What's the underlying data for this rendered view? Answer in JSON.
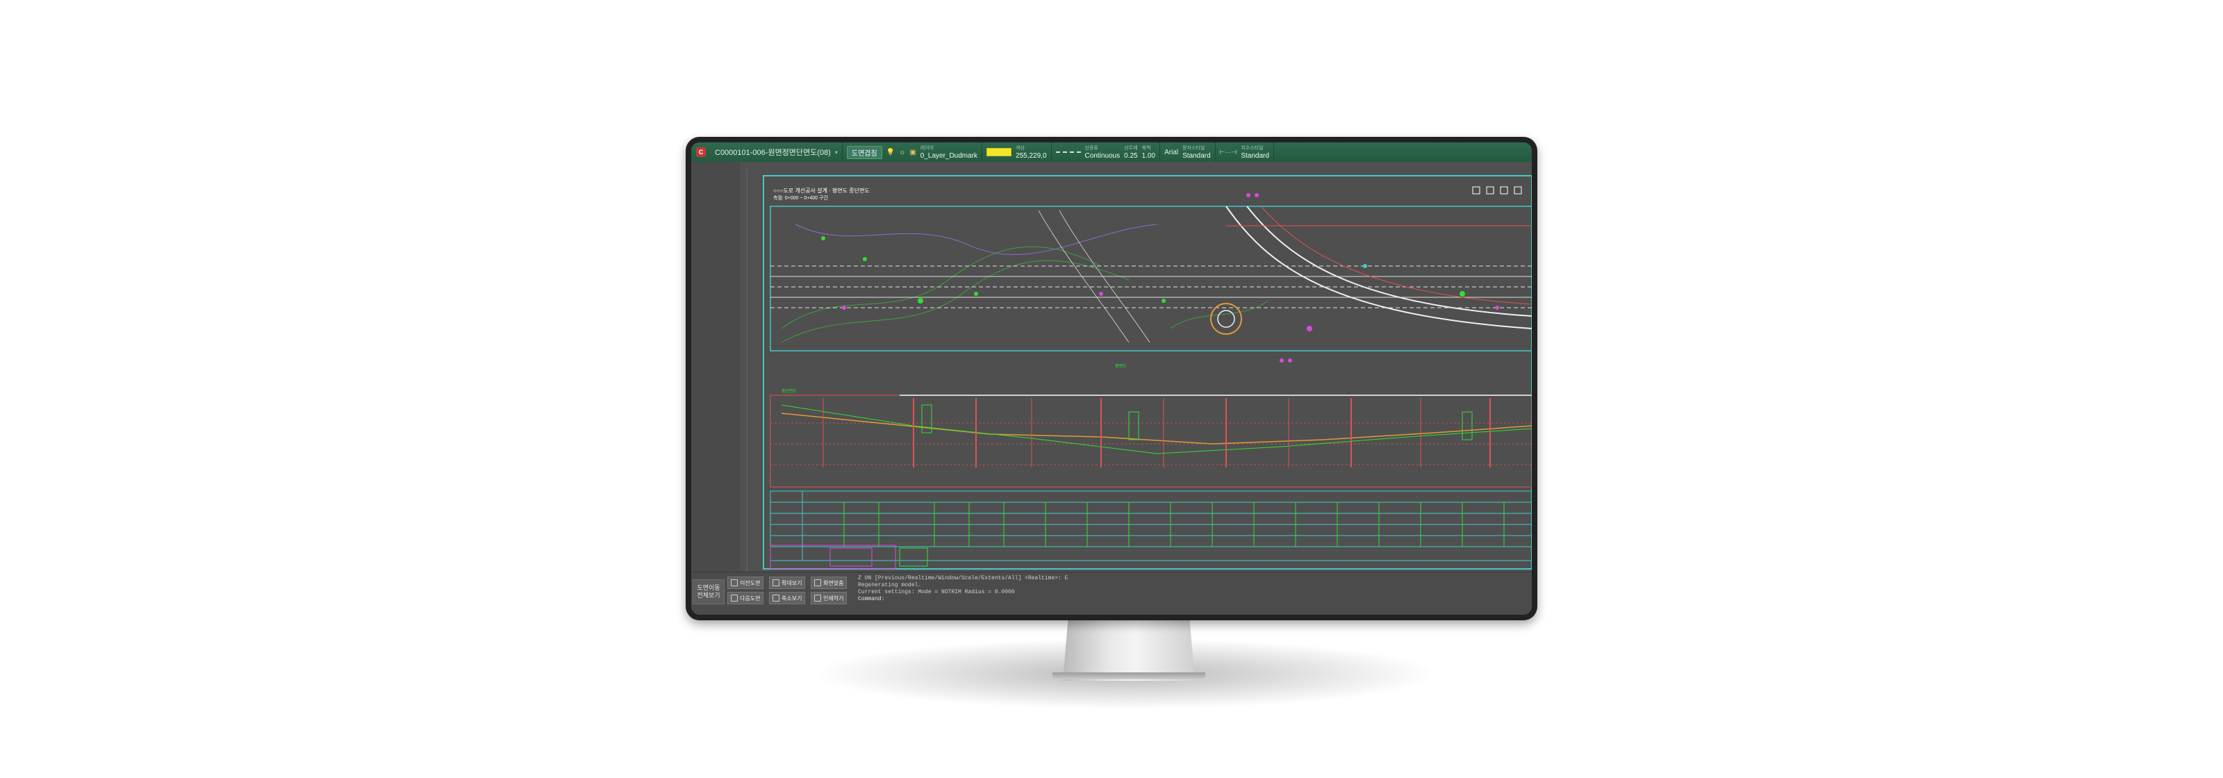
{
  "toolbar": {
    "file_name": "C0000101-006-원면정면단면도(08)",
    "layer_button": "도면겹침",
    "layer_caption": "레이어",
    "layer_name": "0_Layer_Dudmark",
    "color_caption": "색상",
    "color_value": "255,229,0",
    "color_hex": "#f2e62a",
    "linetype_caption": "선종류",
    "linetype_value": "Continuous",
    "lineweight_caption": "선두께",
    "lineweight_value": "0.25",
    "scale_caption": "축척",
    "scale_value": "1.00",
    "font_value": "Arial",
    "textstyle_caption": "문자스타일",
    "textstyle_value": "Standard",
    "dimstyle_caption": "치수스타일",
    "dimstyle_value": "Standard"
  },
  "drawing": {
    "title_line1": "○○○도로 개선공사 설계 · 평면도 종단면도",
    "title_line2": "측점: 0+000 ~ 0+400 구간",
    "plan_label": "평면도",
    "profile_label": "종단면도"
  },
  "bottom": {
    "nav_label": "도면이동\n전체보기",
    "buttons": [
      {
        "label": "이전도면"
      },
      {
        "label": "다음도면"
      },
      {
        "label": "확대보기"
      },
      {
        "label": "축소보기"
      },
      {
        "label": "화면맞춤"
      },
      {
        "label": "인쇄하기"
      }
    ],
    "command_lines": [
      "Z ON  [Previous/Realtime/Window/Scale/Extents/All] <Realtime>: E",
      "Regenerating model.",
      "Current settings: Mode = NOTRIM  Radius = 0.0000"
    ],
    "command_prompt": "Command:"
  }
}
